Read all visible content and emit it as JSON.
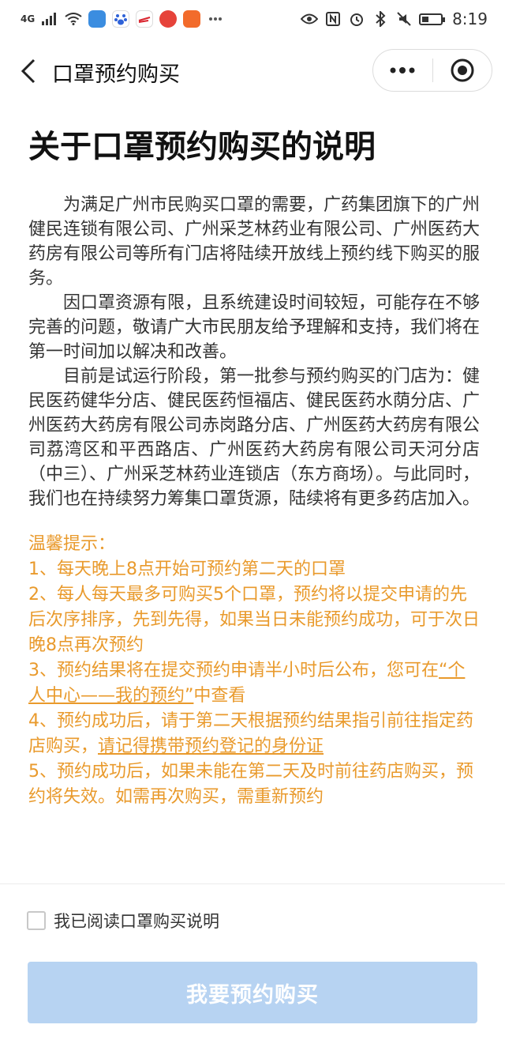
{
  "status_bar": {
    "network": "4G",
    "time": "8:19",
    "icons_left": [
      "signal-icon",
      "wifi-icon",
      "shield-app-icon",
      "baidu-app-icon",
      "sina-app-icon",
      "red-app-icon",
      "orange-app-icon",
      "more-dots-icon"
    ],
    "icons_right": [
      "eye-icon",
      "nfc-icon",
      "alarm-icon",
      "bluetooth-icon",
      "mute-icon",
      "battery-icon"
    ]
  },
  "navbar": {
    "title": "口罩预约购买"
  },
  "document": {
    "title": "关于口罩预约购买的说明",
    "paragraphs": [
      "为满足广州市民购买口罩的需要，广药集团旗下的广州健民连锁有限公司、广州采芝林药业有限公司、广州医药大药房有限公司等所有门店将陆续开放线上预约线下购买的服务。",
      "因口罩资源有限，且系统建设时间较短，可能存在不够完善的问题，敬请广大市民朋友给予理解和支持，我们将在第一时间加以解决和改善。",
      "目前是试运行阶段，第一批参与预约购买的门店为：健民医药健华分店、健民医药恒福店、健民医药水荫分店、广州医药大药房有限公司赤岗路分店、广州医药大药房有限公司荔湾区和平西路店、广州医药大药房有限公司天河分店（中三）、广州采芝林药业连锁店（东方商场）。与此同时，我们也在持续努力筹集口罩货源，陆续将有更多药店加入。"
    ]
  },
  "notice": {
    "heading": "温馨提示：",
    "item1": "1、每天晚上8点开始可预约第二天的口罩",
    "item2": "2、每人每天最多可购买5个口罩，预约将以提交申请的先后次序排序，先到先得，如果当日未能预约成功，可于次日晚8点再次预约",
    "item3_pre": "3、预约结果将在提交预约申请半小时后公布，您可在",
    "item3_link": "“个人中心——我的预约”",
    "item3_post": "中查看",
    "item4_pre": "4、预约成功后，请于第二天根据预约结果指引前往指定药店购买，",
    "item4_underline": "请记得携带预约登记的身份证",
    "item5": "5、预约成功后，如果未能在第二天及时前往药店购买，预约将失效。如需再次购买，需重新预约"
  },
  "agreement": {
    "label": "我已阅读口罩购买说明",
    "checked": false
  },
  "submit": {
    "label": "我要预约购买",
    "disabled": true
  },
  "colors": {
    "notice": "#e99a2c",
    "button_disabled": "#b7d3f2"
  }
}
